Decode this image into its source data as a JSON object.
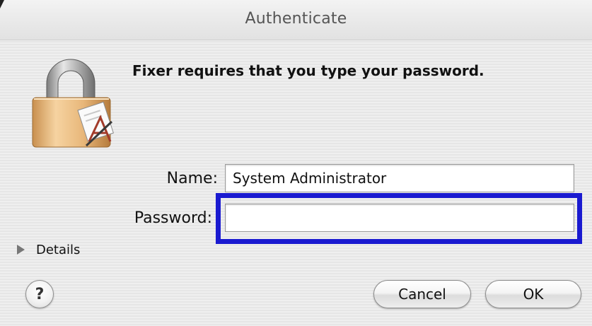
{
  "window": {
    "title": "Authenticate"
  },
  "dialog": {
    "message": "Fixer requires that you type your password.",
    "icon": "lock-icon"
  },
  "form": {
    "name_label": "Name:",
    "name_value": "System Administrator",
    "password_label": "Password:",
    "password_value": ""
  },
  "details": {
    "label": "Details",
    "icon": "disclosure-triangle-icon"
  },
  "buttons": {
    "help_label": "?",
    "cancel_label": "Cancel",
    "ok_label": "OK"
  },
  "colors": {
    "highlight_border": "#1a1ad0"
  }
}
